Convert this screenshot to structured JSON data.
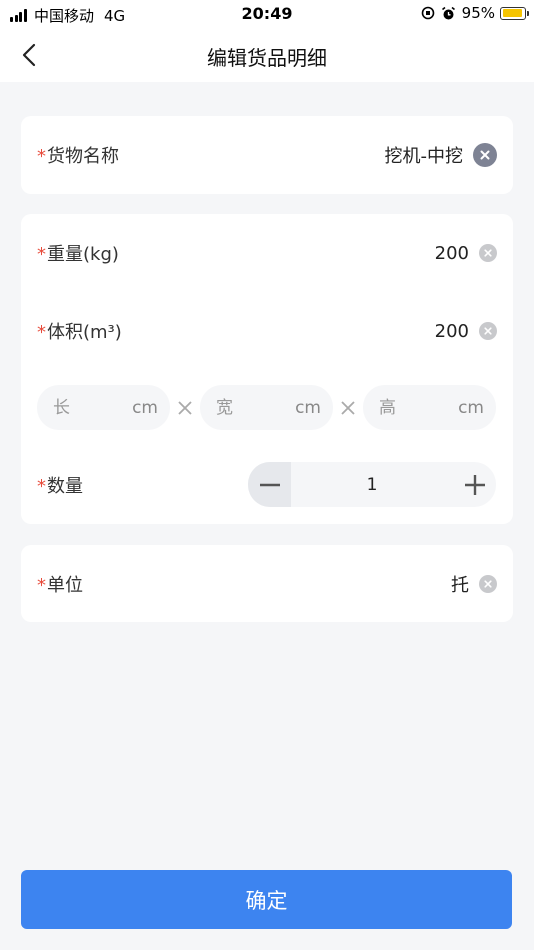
{
  "status_bar": {
    "carrier": "中国移动",
    "network": "4G",
    "time": "20:49",
    "battery_percent": "95%",
    "battery_level": 0.95
  },
  "nav": {
    "title": "编辑货品明细",
    "back_icon": "chevron-left-icon"
  },
  "form": {
    "goods_name": {
      "required_mark": "*",
      "label": "货物名称",
      "value": "挖机-中挖"
    },
    "weight": {
      "required_mark": "*",
      "label": "重量(kg)",
      "value": "200"
    },
    "volume": {
      "required_mark": "*",
      "label": "体积(m³)",
      "value": "200"
    },
    "dimensions": [
      {
        "placeholder": "长",
        "unit": "cm"
      },
      {
        "placeholder": "宽",
        "unit": "cm"
      },
      {
        "placeholder": "高",
        "unit": "cm"
      }
    ],
    "quantity": {
      "required_mark": "*",
      "label": "数量",
      "value": "1"
    },
    "unit": {
      "required_mark": "*",
      "label": "单位",
      "value": "托"
    }
  },
  "confirm_button": "确定",
  "colors": {
    "accent": "#3d84f0",
    "required": "#e74c3c",
    "background": "#f5f6f8"
  }
}
